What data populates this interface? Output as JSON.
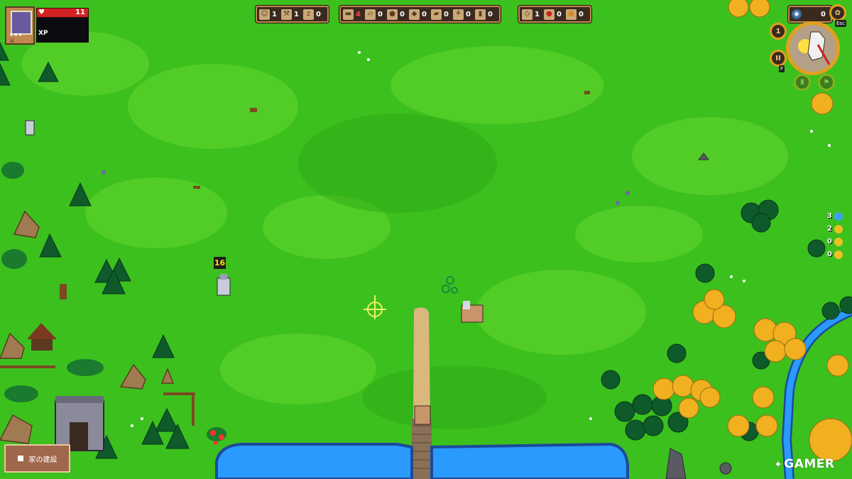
{
  "player": {
    "hp": "11",
    "xp_label": "XP",
    "heart_icon": "heart-icon"
  },
  "hud": {
    "workers": {
      "people": "1",
      "builders": "1",
      "sleeping": "0"
    },
    "materials": {
      "wood_logs": "4",
      "planks": "0",
      "stone": "0",
      "copper": "0",
      "gold": "0",
      "wheat": "0",
      "barrel": "0"
    },
    "food": {
      "fish": "1",
      "apple": "0",
      "beer": "0"
    },
    "coins": "0",
    "day_icon_label": "1",
    "pause_label": "II"
  },
  "keys": {
    "esc": "Esc",
    "pause_key": "F"
  },
  "side_stats": [
    {
      "value": "3",
      "icon": "water-drop-icon",
      "color": "#3aa0ff"
    },
    {
      "value": "2",
      "icon": "sun-icon",
      "color": "#f0c020"
    },
    {
      "value": "0",
      "icon": "ankh-icon",
      "color": "#f0c020"
    },
    {
      "value": "0",
      "icon": "smiley-icon",
      "color": "#f0c020"
    }
  ],
  "damage_popup": "16",
  "build_button": {
    "label": "家の建設"
  },
  "watermark": "GAMER",
  "colors": {
    "grass": "#3cc01e",
    "grass_light": "#62d42c",
    "water": "#2a9aff",
    "hud_bg": "#3a2a1e",
    "hud_border": "#c08850",
    "hp_red": "#d22222",
    "gold_ring": "#e0a020"
  }
}
